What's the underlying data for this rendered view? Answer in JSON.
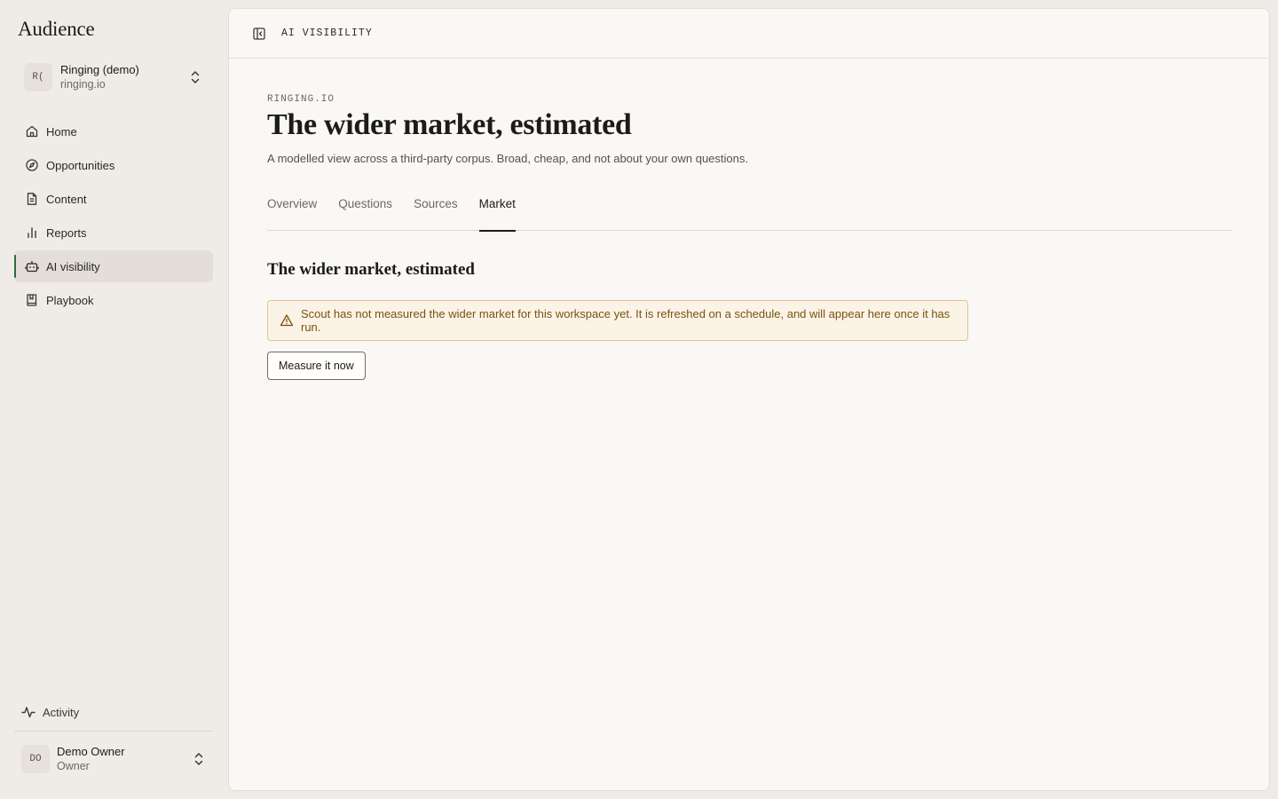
{
  "app": {
    "title": "Audience"
  },
  "workspace": {
    "initials": "R(",
    "name": "Ringing (demo)",
    "domain": "ringing.io"
  },
  "sidebar": {
    "items": [
      {
        "label": "Home",
        "icon": "home-icon"
      },
      {
        "label": "Opportunities",
        "icon": "compass-icon"
      },
      {
        "label": "Content",
        "icon": "document-icon"
      },
      {
        "label": "Reports",
        "icon": "bar-chart-icon"
      },
      {
        "label": "AI visibility",
        "icon": "robot-icon",
        "active": true
      },
      {
        "label": "Playbook",
        "icon": "book-icon"
      }
    ],
    "activity_label": "Activity"
  },
  "user": {
    "initials": "DO",
    "name": "Demo Owner",
    "role": "Owner"
  },
  "header": {
    "breadcrumb": "AI VISIBILITY"
  },
  "page": {
    "eyebrow": "RINGING.IO",
    "title": "The wider market, estimated",
    "subtitle": "A modelled view across a third-party corpus. Broad, cheap, and not about your own questions."
  },
  "tabs": [
    {
      "label": "Overview"
    },
    {
      "label": "Questions"
    },
    {
      "label": "Sources"
    },
    {
      "label": "Market",
      "active": true
    }
  ],
  "section": {
    "title": "The wider market, estimated",
    "alert": "Scout has not measured the wider market for this workspace yet. It is refreshed on a schedule, and will appear here once it has run.",
    "button_label": "Measure it now"
  },
  "colors": {
    "accent": "#2f6b3d",
    "warning_bg": "#fbf3e6",
    "warning_text": "#7a5210"
  }
}
